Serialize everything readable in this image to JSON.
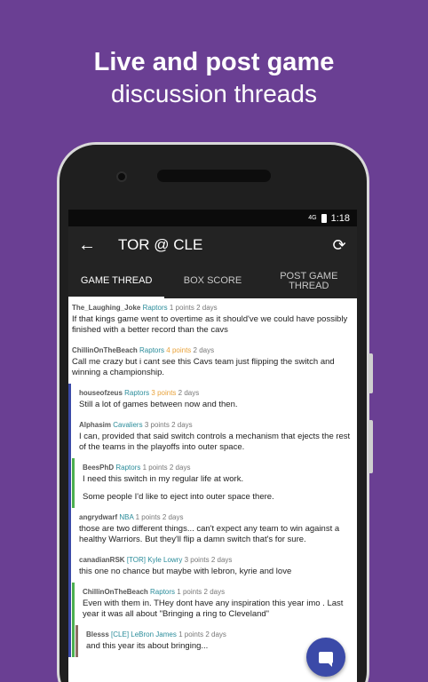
{
  "promo": {
    "line1": "Live and post game",
    "line2": "discussion threads"
  },
  "status": {
    "network": "4G",
    "time": "1:18"
  },
  "appbar": {
    "back_icon": "←",
    "title": "TOR @ CLE",
    "refresh_icon": "⟳"
  },
  "tabs": [
    {
      "label": "GAME THREAD",
      "active": true
    },
    {
      "label": "BOX SCORE",
      "active": false
    },
    {
      "label": "POST GAME\nTHREAD",
      "active": false
    }
  ],
  "comments": [
    {
      "user": "The_Laughing_Joke",
      "flair": "Raptors",
      "points": "1 points",
      "age": "2 days",
      "depth": 0,
      "hot": false,
      "body": [
        "If that kings game went to overtime as it should've we could have possibly finished with a better record than the cavs"
      ]
    },
    {
      "user": "ChillinOnTheBeach",
      "flair": "Raptors",
      "points": "4 points",
      "age": "2 days",
      "depth": 0,
      "hot": true,
      "body": [
        "Call me crazy but i cant see this Cavs team just flipping the switch and winning a championship."
      ]
    },
    {
      "user": "houseofzeus",
      "flair": "Raptors",
      "points": "3 points",
      "age": "2 days",
      "depth": 1,
      "hot": true,
      "body": [
        "Still a lot of games between now and then."
      ]
    },
    {
      "user": "Alphasim",
      "flair": "Cavaliers",
      "points": "3 points",
      "age": "2 days",
      "depth": 1,
      "hot": false,
      "body": [
        "I can, provided that said switch controls a mechanism that ejects the rest of the teams in the playoffs into outer space."
      ]
    },
    {
      "user": "BeesPhD",
      "flair": "Raptors",
      "points": "1 points",
      "age": "2 days",
      "depth": 2,
      "hot": false,
      "body": [
        "I need this switch in my regular life at work.",
        "Some people I'd like to eject into outer space there."
      ]
    },
    {
      "user": "angrydwarf",
      "flair": "NBA",
      "points": "1 points",
      "age": "2 days",
      "depth": 1,
      "hot": false,
      "body": [
        "those are two different things... can't expect any team to win against a healthy Warriors. But they'll flip a damn switch that's for sure."
      ]
    },
    {
      "user": "canadianRSK",
      "flair": "[TOR] Kyle Lowry",
      "points": "3 points",
      "age": "2 days",
      "depth": 1,
      "hot": false,
      "body": [
        "this one no chance but maybe with lebron, kyrie and love"
      ]
    },
    {
      "user": "ChillinOnTheBeach",
      "flair": "Raptors",
      "points": "1 points",
      "age": "2 days",
      "depth": 2,
      "hot": false,
      "body": [
        "Even with them in. THey dont have any inspiration this year imo . Last year it was all about \"Bringing a ring to Cleveland\""
      ]
    },
    {
      "user": "Blesss",
      "flair": "[CLE] LeBron James",
      "points": "1 points",
      "age": "2 days",
      "depth": 3,
      "hot": false,
      "body": [
        "and this year its about bringing..."
      ]
    }
  ],
  "colors": {
    "background": "#6a3f93",
    "depth1": "#3b4aa8",
    "depth2": "#4caf50",
    "depth3": "#8d6e63",
    "flair": "#2a8c9a",
    "hot_points": "#e8a23a",
    "fab": "#3b4aa8"
  },
  "fab": {
    "icon": "chat-icon"
  }
}
